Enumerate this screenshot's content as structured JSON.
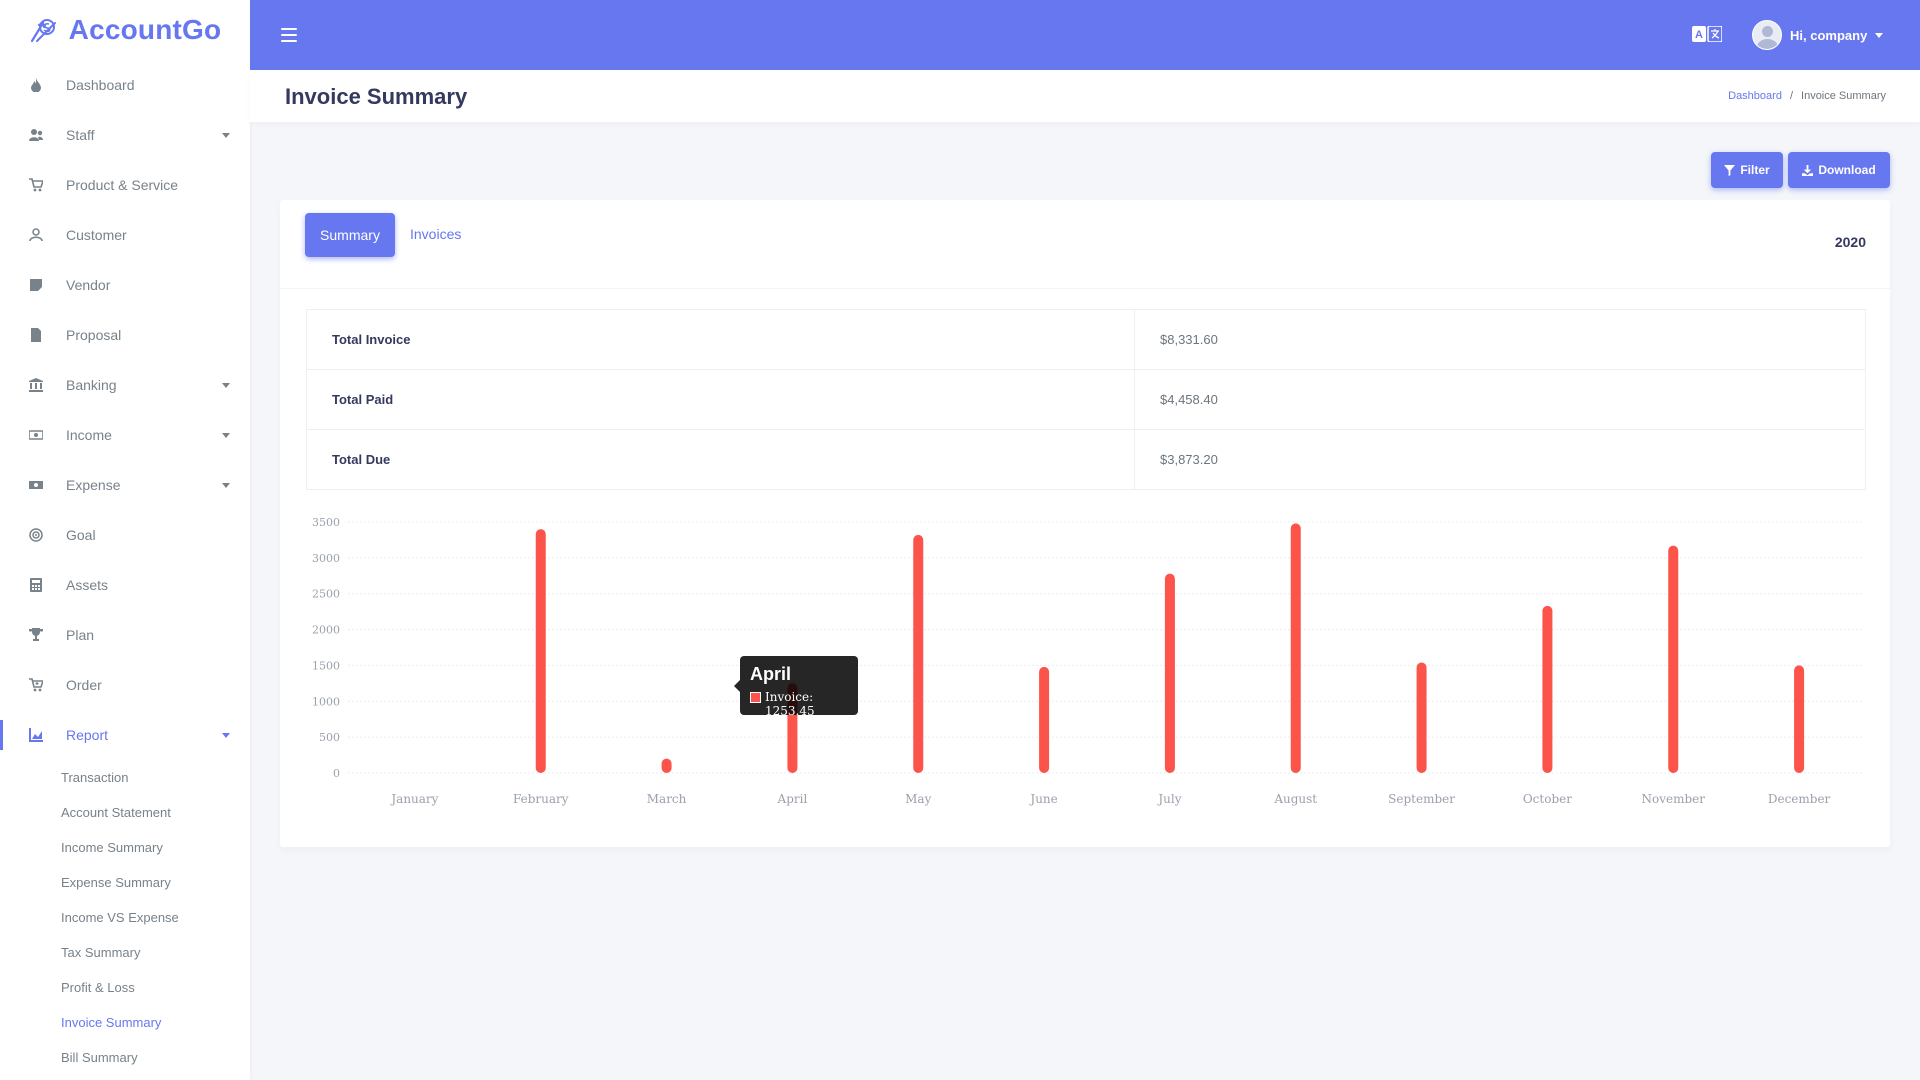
{
  "app": {
    "name": "AccountGo"
  },
  "sidebar": {
    "items": [
      {
        "label": "Dashboard",
        "icon": "fire-icon",
        "caret": false
      },
      {
        "label": "Staff",
        "icon": "users-icon",
        "caret": true
      },
      {
        "label": "Product & Service",
        "icon": "cart-icon",
        "caret": false
      },
      {
        "label": "Customer",
        "icon": "user-icon",
        "caret": false
      },
      {
        "label": "Vendor",
        "icon": "note-icon",
        "caret": false
      },
      {
        "label": "Proposal",
        "icon": "file-icon",
        "caret": false
      },
      {
        "label": "Banking",
        "icon": "bank-icon",
        "caret": true
      },
      {
        "label": "Income",
        "icon": "money-icon",
        "caret": true
      },
      {
        "label": "Expense",
        "icon": "money-bill-icon",
        "caret": true
      },
      {
        "label": "Goal",
        "icon": "bullseye-icon",
        "caret": false
      },
      {
        "label": "Assets",
        "icon": "calculator-icon",
        "caret": false
      },
      {
        "label": "Plan",
        "icon": "trophy-icon",
        "caret": false
      },
      {
        "label": "Order",
        "icon": "cart-plus-icon",
        "caret": false
      },
      {
        "label": "Report",
        "icon": "chart-area-icon",
        "caret": true,
        "active": true
      }
    ],
    "report_submenu": [
      "Transaction",
      "Account Statement",
      "Income Summary",
      "Expense Summary",
      "Income VS Expense",
      "Tax Summary",
      "Profit & Loss",
      "Invoice Summary",
      "Bill Summary"
    ],
    "active_submenu": "Invoice Summary"
  },
  "navbar": {
    "user_greeting": "Hi, company",
    "translate_icon": "translate-icon",
    "menu_icon": "hamburger-icon"
  },
  "header": {
    "title": "Invoice Summary",
    "breadcrumb": [
      "Dashboard",
      "Invoice Summary"
    ]
  },
  "actions": {
    "filter_label": "Filter",
    "download_label": "Download"
  },
  "tabs": {
    "summary": "Summary",
    "invoices": "Invoices"
  },
  "year": "2020",
  "summary_rows": [
    {
      "label": "Total Invoice",
      "value": "$8,331.60"
    },
    {
      "label": "Total Paid",
      "value": "$4,458.40"
    },
    {
      "label": "Total Due",
      "value": "$3,873.20"
    }
  ],
  "tooltip": {
    "title": "April",
    "label": "Invoice: 1253.45"
  },
  "colors": {
    "accent": "#6777ef",
    "bar": "#fc544b",
    "text": "#34395e",
    "muted": "#78828a"
  },
  "chart_data": {
    "type": "bar",
    "categories": [
      "January",
      "February",
      "March",
      "April",
      "May",
      "June",
      "July",
      "August",
      "September",
      "October",
      "November",
      "December"
    ],
    "series": [
      {
        "name": "Invoice",
        "values": [
          0,
          3400,
          200,
          1253.45,
          3320,
          1480,
          2780,
          3480,
          1540,
          2330,
          3170,
          1500
        ]
      }
    ],
    "ylim": [
      0,
      3500
    ],
    "yticks": [
      0,
      500,
      1000,
      1500,
      2000,
      2500,
      3000,
      3500
    ],
    "grid": true
  }
}
